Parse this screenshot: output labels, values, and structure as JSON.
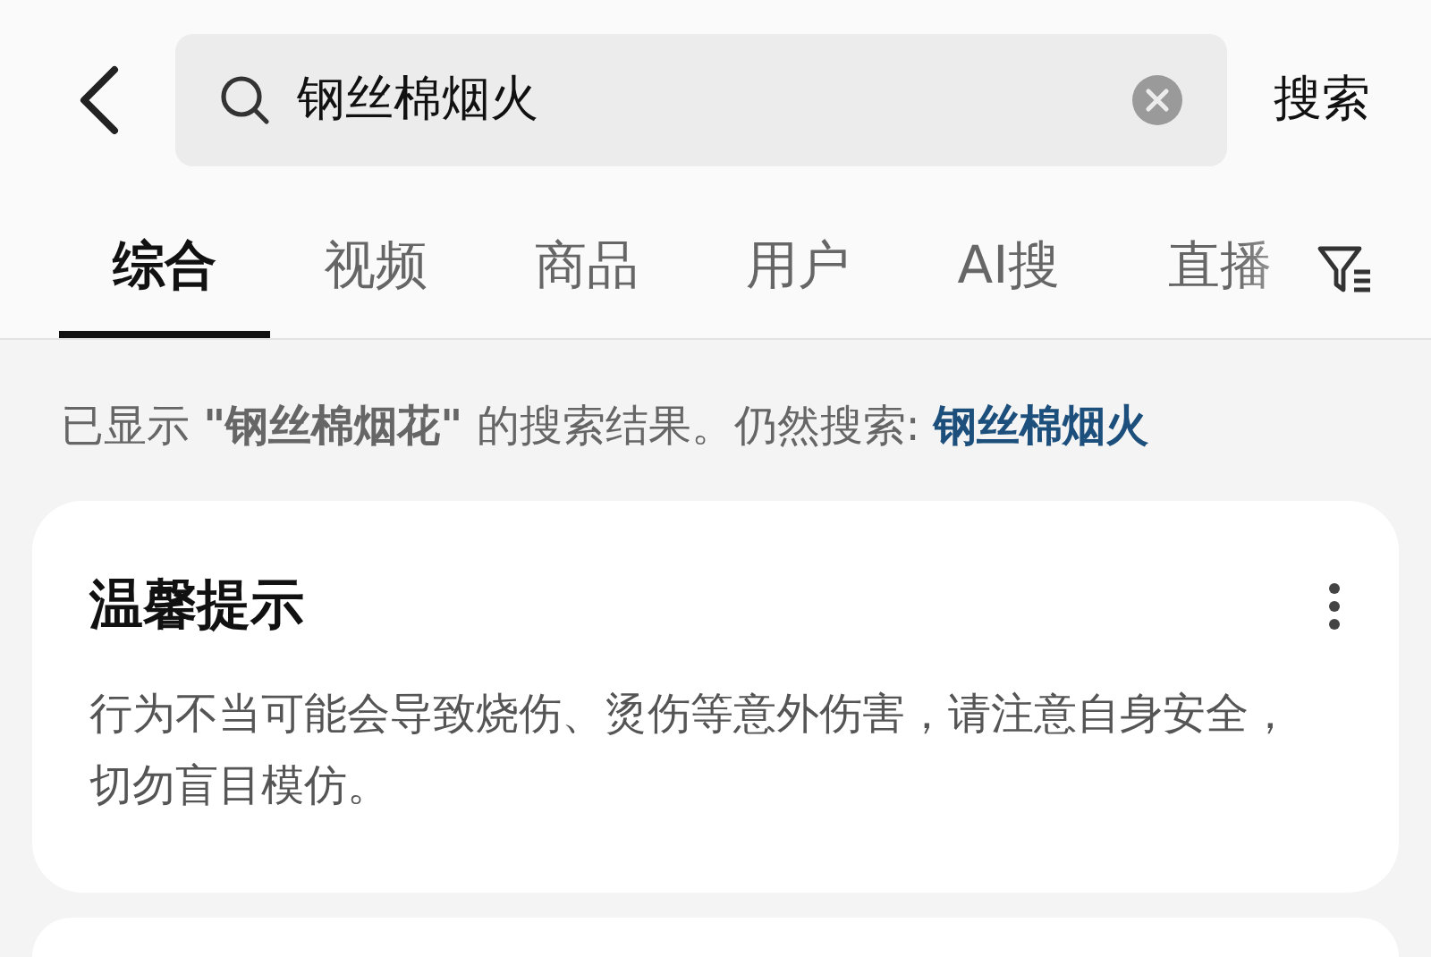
{
  "search": {
    "value": "钢丝棉烟火",
    "button": "搜索"
  },
  "tabs": [
    {
      "label": "综合",
      "selected": true
    },
    {
      "label": "视频",
      "selected": false
    },
    {
      "label": "商品",
      "selected": false
    },
    {
      "label": "用户",
      "selected": false
    },
    {
      "label": "AI搜",
      "selected": false
    },
    {
      "label": "直播",
      "selected": false
    }
  ],
  "notice": {
    "text": "已显示 **\"钢丝棉烟花\"** 的搜索结果。仍然搜索: ",
    "link": "钢丝棉烟火"
  },
  "card": {
    "title": "温馨提示",
    "body": "行为不当可能会导致烧伤、烫伤等意外伤害，请注意自身安全，切勿盲目模仿。"
  }
}
